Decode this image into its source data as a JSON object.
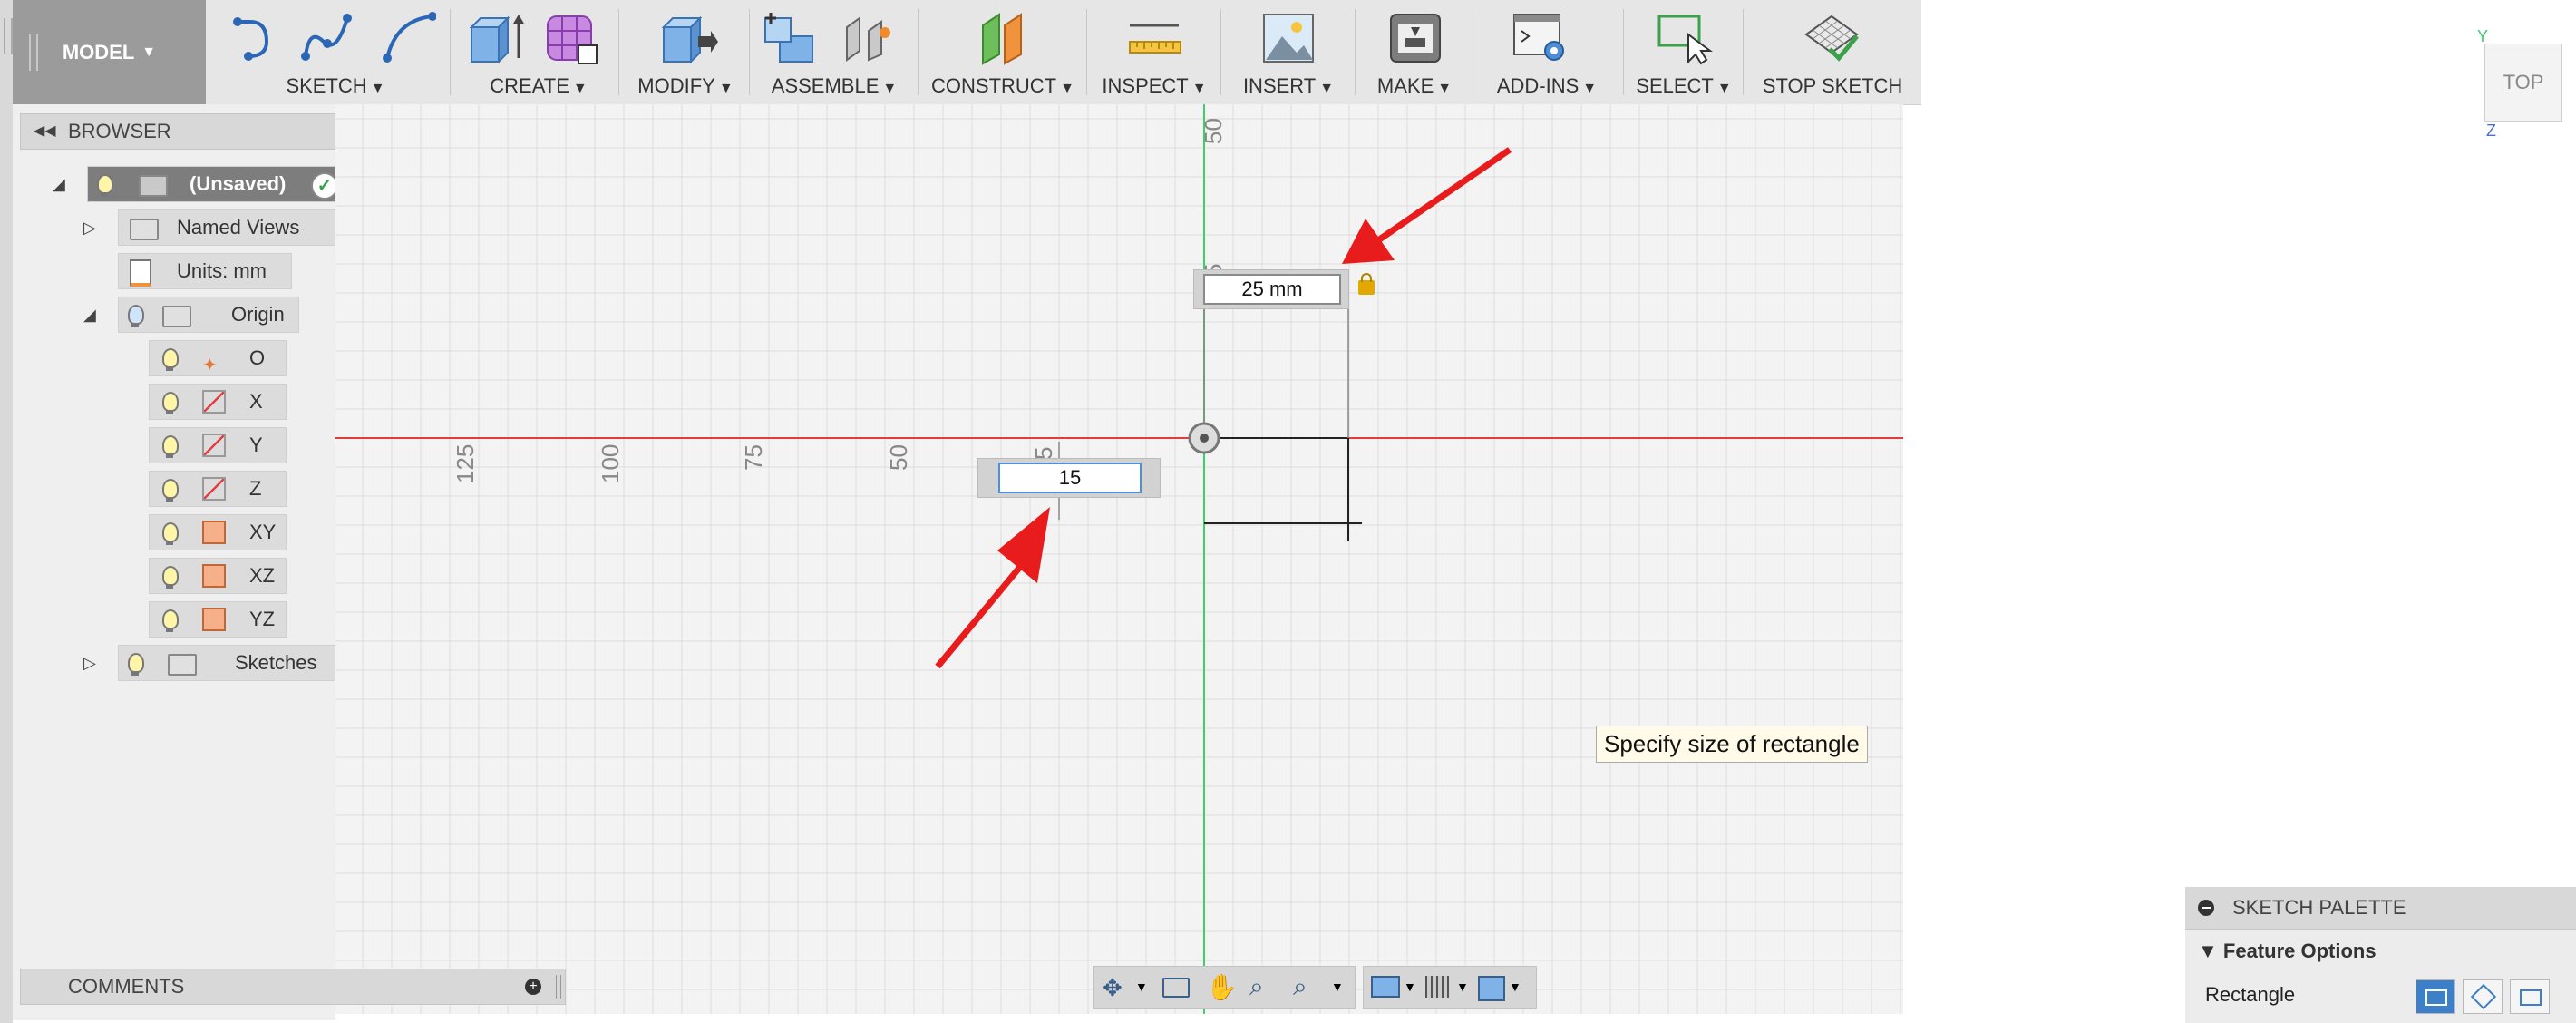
{
  "toolbar": {
    "model_label": "MODEL",
    "groups": [
      {
        "label": "SKETCH"
      },
      {
        "label": "CREATE"
      },
      {
        "label": "MODIFY"
      },
      {
        "label": "ASSEMBLE"
      },
      {
        "label": "CONSTRUCT"
      },
      {
        "label": "INSPECT"
      },
      {
        "label": "INSERT"
      },
      {
        "label": "MAKE"
      },
      {
        "label": "ADD-INS"
      },
      {
        "label": "SELECT"
      }
    ],
    "stop_sketch_label": "STOP SKETCH"
  },
  "browser": {
    "title": "BROWSER",
    "root": "(Unsaved)",
    "named_views": "Named Views",
    "units": "Units: mm",
    "origin": "Origin",
    "origin_items": [
      "O",
      "X",
      "Y",
      "Z",
      "XY",
      "XZ",
      "YZ"
    ],
    "sketches": "Sketches"
  },
  "canvas": {
    "ruler_labels": [
      "125",
      "100",
      "75",
      "50",
      "5",
      "50",
      "5"
    ],
    "dim_width_value": "25 mm",
    "dim_height_value": "15",
    "tooltip": "Specify size of rectangle"
  },
  "comments": {
    "title": "COMMENTS"
  },
  "viewcube": {
    "face": "TOP",
    "axis_y": "Y",
    "axis_z": "Z"
  },
  "sketch_palette": {
    "title": "SKETCH PALETTE",
    "section": "Feature Options",
    "row_label": "Rectangle"
  },
  "colors": {
    "x_axis": "#e33b3b",
    "y_axis": "#3ecf6a",
    "arrow": "#e81c1c",
    "toolbar_bg": "#e6e6e6",
    "model_bg": "#9b9b9b"
  }
}
